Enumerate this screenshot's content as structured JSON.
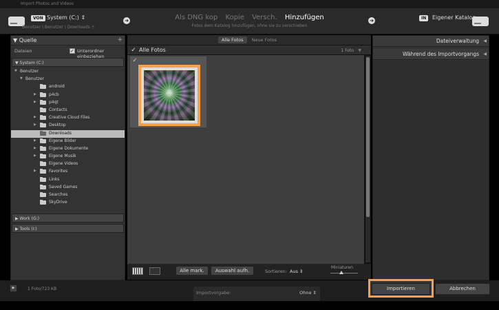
{
  "window": {
    "title": "Import Photos and Videos"
  },
  "source": {
    "badge": "VON",
    "name": "System (C:)",
    "name_arrow": "⇕",
    "path": "Benutzer \\ Benutzer \\ Downloads ÷"
  },
  "modes": {
    "items": [
      "Als DNG kop",
      "Kopie",
      "Versch.",
      "Hinzufügen"
    ],
    "active_index": 3,
    "description": "Fotos dem Katalog hinzufügen, ohne sie zu verschieben"
  },
  "destination": {
    "badge": "IN",
    "name": "Eigener Katalog"
  },
  "left_panel": {
    "title": "Quelle",
    "add": "+",
    "files_label": "Dateien",
    "subfolders_label": "Unterordner einbeziehen",
    "subfolders_checked": true,
    "volumes": [
      {
        "label": "System (C:)"
      },
      {
        "label": "Work (G:)"
      },
      {
        "label": "Tools (I:)"
      }
    ],
    "tree": [
      {
        "name": "Benutzer",
        "level": 0,
        "expanded": true,
        "folder": false
      },
      {
        "name": "Benutzer",
        "level": 1,
        "expanded": true,
        "folder": false
      },
      {
        "name": "android",
        "level": 2,
        "children": false,
        "folder": true
      },
      {
        "name": "p4cb",
        "level": 2,
        "children": true,
        "folder": true
      },
      {
        "name": "p4qt",
        "level": 2,
        "children": true,
        "folder": true
      },
      {
        "name": "Contacts",
        "level": 2,
        "children": false,
        "folder": true
      },
      {
        "name": "Creative Cloud Files",
        "level": 2,
        "children": true,
        "folder": true
      },
      {
        "name": "Desktop",
        "level": 2,
        "children": true,
        "folder": true
      },
      {
        "name": "Downloads",
        "level": 2,
        "children": false,
        "folder": true,
        "selected": true
      },
      {
        "name": "Eigene Bilder",
        "level": 2,
        "children": true,
        "folder": true
      },
      {
        "name": "Eigene Dokumente",
        "level": 2,
        "children": true,
        "folder": true
      },
      {
        "name": "Eigene Musik",
        "level": 2,
        "children": true,
        "folder": true
      },
      {
        "name": "Eigene Videos",
        "level": 2,
        "children": false,
        "folder": true
      },
      {
        "name": "Favorites",
        "level": 2,
        "children": true,
        "folder": true
      },
      {
        "name": "Links",
        "level": 2,
        "children": false,
        "folder": true
      },
      {
        "name": "Saved Games",
        "level": 2,
        "children": false,
        "folder": true
      },
      {
        "name": "Searches",
        "level": 2,
        "children": false,
        "folder": true
      },
      {
        "name": "SkyDrive",
        "level": 2,
        "children": false,
        "folder": true
      }
    ]
  },
  "center": {
    "tabs": [
      "Alle Fotos",
      "Neue Fotos"
    ],
    "active_tab": 0,
    "header_title": "Alle Fotos",
    "header_count": "1 Foto",
    "photos": [
      {
        "checked": true,
        "highlighted": true
      }
    ],
    "check_all": "Alle mark.",
    "uncheck_all": "Auswahl aufh.",
    "sort_label": "Sortieren:",
    "sort_value": "Aus ⇕",
    "thumbnails_label": "Miniaturen",
    "thumbnail_size": 0.4
  },
  "right_panel": {
    "sections": [
      "Dateiverwaltung",
      "Während des Importvorgangs"
    ]
  },
  "bottom": {
    "expand": "▶",
    "status": "1 Foto/723 KB",
    "preset_label": "Importvorgabe:",
    "preset_value": "Ohne ⇕",
    "import_label": "Importieren",
    "cancel_label": "Abbrechen"
  },
  "colors": {
    "highlight": "#f5a04a",
    "background": "#2a2a2a"
  }
}
